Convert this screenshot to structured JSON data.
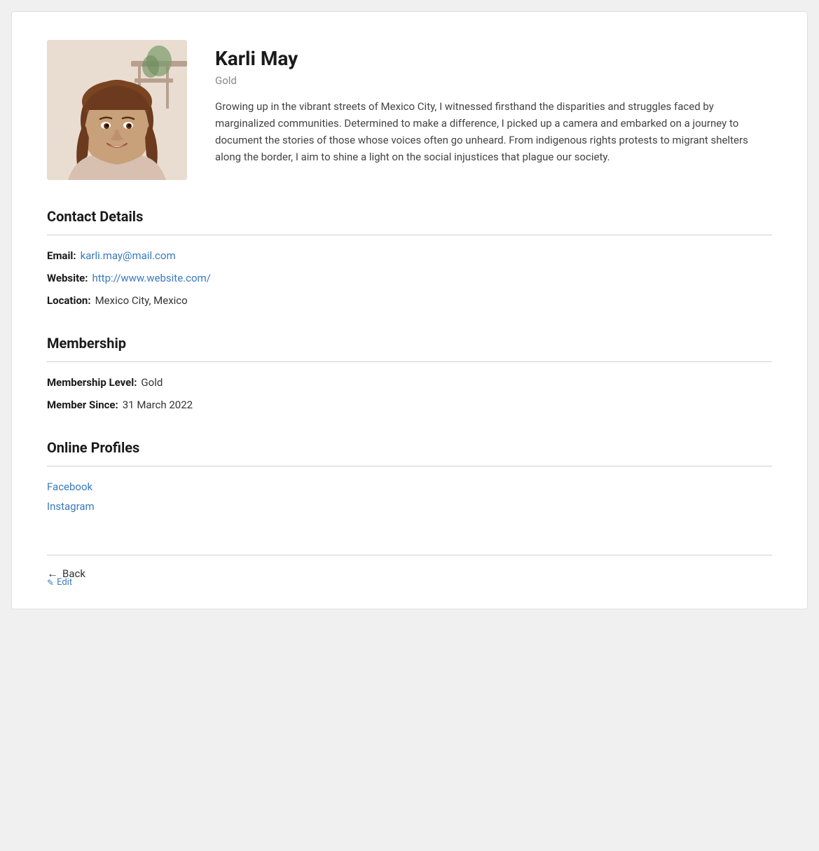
{
  "profile": {
    "name": "Karli May",
    "tier": "Gold",
    "bio": "Growing up in the vibrant streets of Mexico City, I witnessed firsthand the disparities and struggles faced by marginalized communities. Determined to make a difference, I picked up a camera and embarked on a journey to document the stories of those whose voices often go unheard. From indigenous rights protests to migrant shelters along the border, I aim to shine a light on the social injustices that plague our society."
  },
  "contact": {
    "section_title": "Contact Details",
    "email_label": "Email:",
    "email_value": "karli.may@mail.com",
    "email_href": "mailto:karli.may@mail.com",
    "website_label": "Website:",
    "website_value": "http://www.website.com/",
    "website_href": "http://www.website.com/",
    "location_label": "Location:",
    "location_value": "Mexico City, Mexico"
  },
  "membership": {
    "section_title": "Membership",
    "level_label": "Membership Level:",
    "level_value": "Gold",
    "since_label": "Member Since:",
    "since_value": "31 March 2022"
  },
  "online_profiles": {
    "section_title": "Online Profiles",
    "links": [
      {
        "label": "Facebook",
        "href": "#"
      },
      {
        "label": "Instagram",
        "href": "#"
      }
    ]
  },
  "footer": {
    "back_label": "Back",
    "edit_label": "Edit"
  }
}
